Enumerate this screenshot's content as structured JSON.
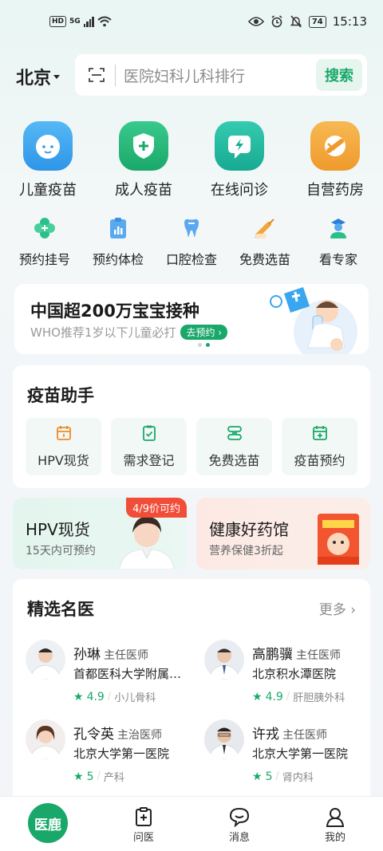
{
  "status_bar": {
    "hd": "HD",
    "network": "5G",
    "battery": "74",
    "time": "15:13"
  },
  "header": {
    "city": "北京",
    "search_placeholder": "医院妇科儿科排行",
    "search_button": "搜索"
  },
  "main_services": [
    {
      "label": "儿童疫苗",
      "icon": "baby-face-icon",
      "color": "#3aa6f0"
    },
    {
      "label": "成人疫苗",
      "icon": "shield-plus-icon",
      "color": "#22b27a"
    },
    {
      "label": "在线问诊",
      "icon": "chat-lightning-icon",
      "color": "#1fb89a"
    },
    {
      "label": "自营药房",
      "icon": "pill-icon",
      "color": "#f3a53a"
    }
  ],
  "sub_services": [
    {
      "label": "预约挂号",
      "icon": "clover-icon"
    },
    {
      "label": "预约体检",
      "icon": "clipboard-chart-icon"
    },
    {
      "label": "口腔检查",
      "icon": "tooth-icon"
    },
    {
      "label": "免费选苗",
      "icon": "syringe-icon"
    },
    {
      "label": "看专家",
      "icon": "doctor-icon"
    }
  ],
  "banner": {
    "title": "中国超200万宝宝接种",
    "subtitle": "WHO推荐1岁以下儿童必打",
    "cta": "去预约"
  },
  "vaccine_helper": {
    "title": "疫苗助手",
    "items": [
      {
        "label": "HPV现货",
        "icon": "calendar-icon"
      },
      {
        "label": "需求登记",
        "icon": "clipboard-check-icon"
      },
      {
        "label": "免费选苗",
        "icon": "layers-icon"
      },
      {
        "label": "疫苗预约",
        "icon": "calendar-plus-icon"
      }
    ]
  },
  "promos": {
    "left": {
      "title": "HPV现货",
      "subtitle": "15天内可预约",
      "tag": "4/9价可约"
    },
    "right": {
      "title": "健康好药馆",
      "subtitle": "营养保健3折起"
    }
  },
  "doctors": {
    "title": "精选名医",
    "more": "更多",
    "items": [
      {
        "name": "孙琳",
        "title": "主任医师",
        "hospital": "首都医科大学附属北京儿童医院",
        "rating": "4.9",
        "dept": "小儿骨科"
      },
      {
        "name": "高鹏骥",
        "title": "主任医师",
        "hospital": "北京积水潭医院",
        "rating": "4.9",
        "dept": "肝胆胰外科"
      },
      {
        "name": "孔令英",
        "title": "主治医师",
        "hospital": "北京大学第一医院",
        "rating": "5",
        "dept": "产科"
      },
      {
        "name": "许戎",
        "title": "主任医师",
        "hospital": "北京大学第一医院",
        "rating": "5",
        "dept": "肾内科"
      }
    ]
  },
  "tabbar": {
    "home": "医鹿",
    "items": [
      {
        "label": "问医",
        "icon": "medical-clipboard-icon"
      },
      {
        "label": "消息",
        "icon": "chat-bubble-icon"
      },
      {
        "label": "我的",
        "icon": "person-icon"
      }
    ]
  },
  "colors": {
    "brand": "#1aa86a",
    "tag_red": "#f14e3a"
  }
}
